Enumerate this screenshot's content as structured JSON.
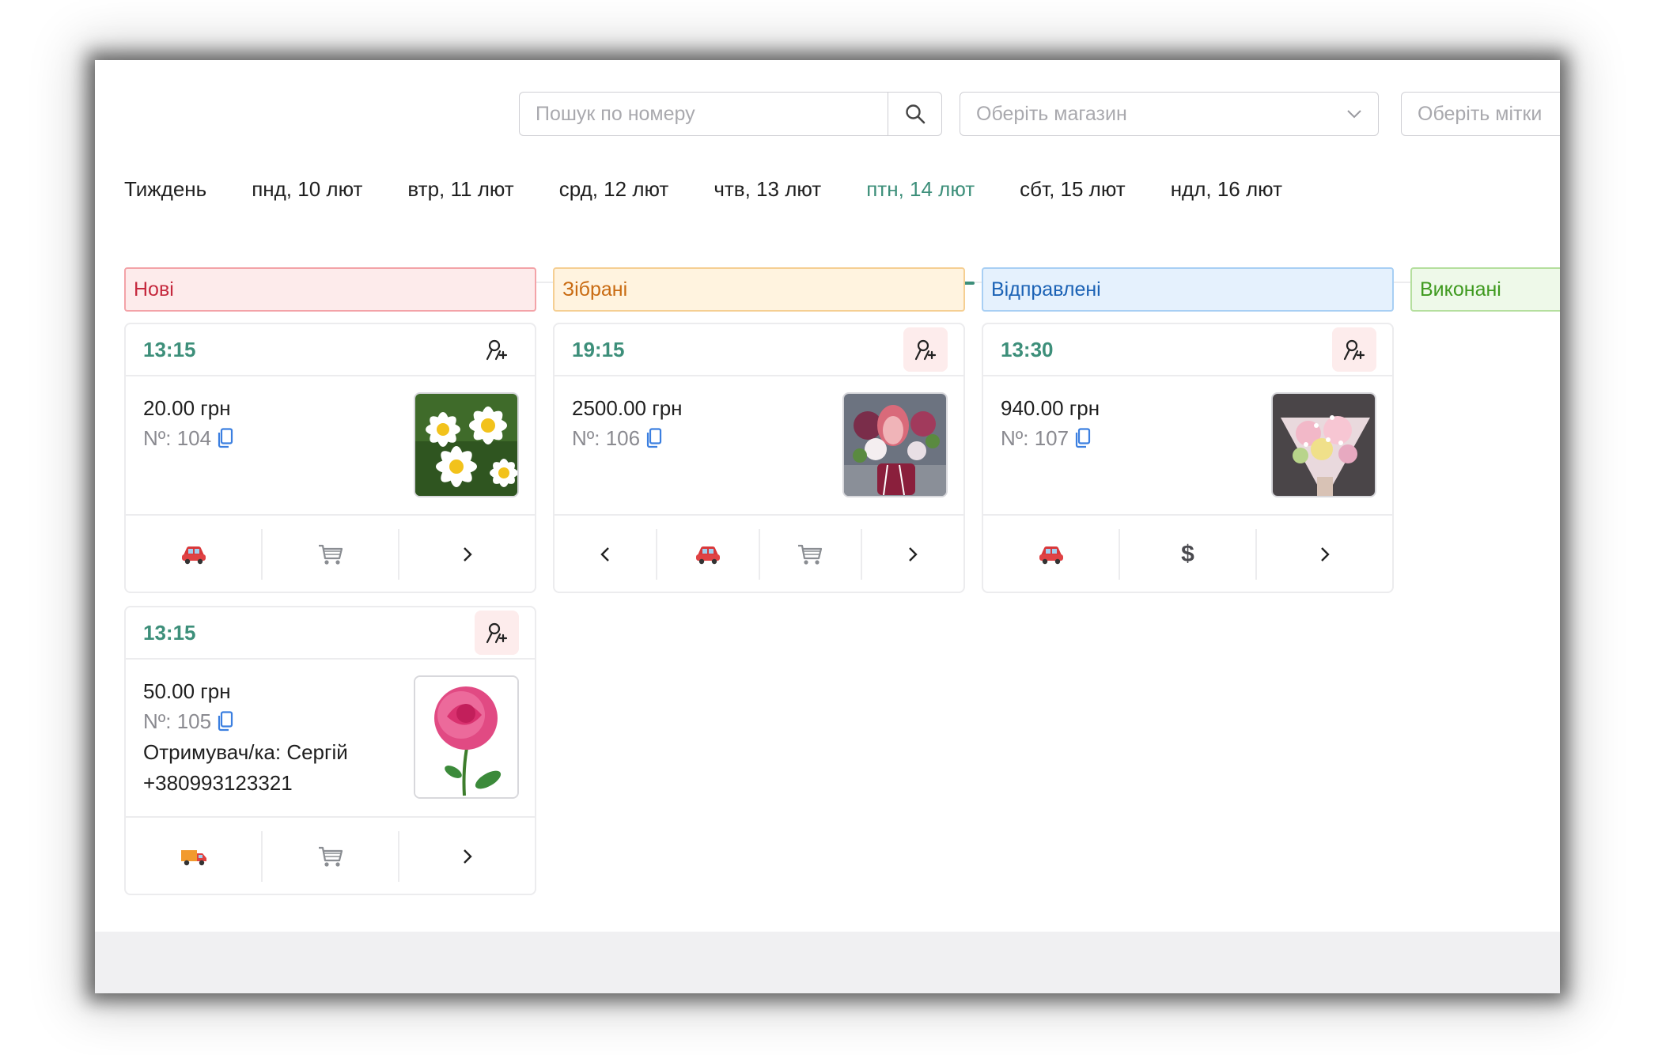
{
  "search": {
    "placeholder": "Пошук по номеру"
  },
  "filters": {
    "shop_placeholder": "Оберіть магазин",
    "tags_placeholder": "Оберіть мітки"
  },
  "tabs": [
    {
      "label": "Тиждень",
      "active": false
    },
    {
      "label": "пнд, 10 лют",
      "active": false
    },
    {
      "label": "втр, 11 лют",
      "active": false
    },
    {
      "label": "срд, 12 лют",
      "active": false
    },
    {
      "label": "чтв, 13 лют",
      "active": false
    },
    {
      "label": "птн, 14 лют",
      "active": true
    },
    {
      "label": "сбт, 15 лют",
      "active": false
    },
    {
      "label": "ндл, 16 лют",
      "active": false
    }
  ],
  "columns": {
    "new": {
      "title": "Нові"
    },
    "collected": {
      "title": "Зібрані"
    },
    "sent": {
      "title": "Відправлені"
    },
    "done": {
      "title": "Виконані"
    }
  },
  "orders": {
    "o104": {
      "time": "13:15",
      "price": "20.00 грн",
      "number": "Nº: 104",
      "image": "daisies",
      "actions": [
        "car-icon",
        "cart-icon",
        "chevron-right-icon"
      ]
    },
    "o105": {
      "time": "13:15",
      "price": "50.00 грн",
      "number": "Nº: 105",
      "recipient": "Отримувач/ка: Сергій",
      "phone": "+380993123321",
      "image": "pink-rose",
      "actions": [
        "truck-icon",
        "cart-icon",
        "chevron-right-icon"
      ]
    },
    "o106": {
      "time": "19:15",
      "price": "2500.00 грн",
      "number": "Nº: 106",
      "image": "protea-bouquet",
      "actions": [
        "chevron-left-icon",
        "car-icon",
        "cart-icon",
        "chevron-right-icon"
      ]
    },
    "o107": {
      "time": "13:30",
      "price": "940.00 грн",
      "number": "Nº: 107",
      "image": "pastel-bouquet",
      "actions": [
        "car-icon",
        "dollar-icon",
        "chevron-right-icon"
      ],
      "dollar_label": "$"
    }
  },
  "colors": {
    "accent": "#3d8f7a",
    "new": "#c5283d",
    "collected": "#c96b12",
    "sent": "#1b62b5",
    "done": "#3f9a1f"
  }
}
